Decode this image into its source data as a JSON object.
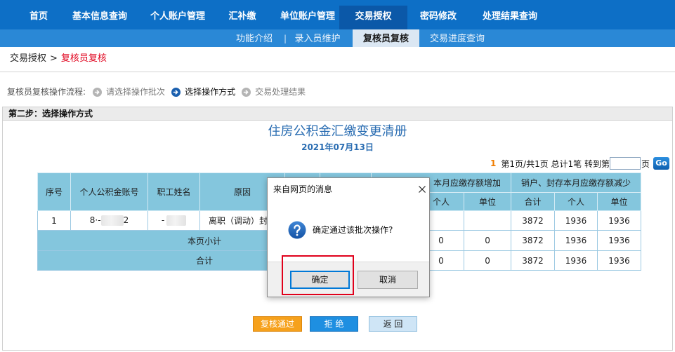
{
  "colors": {
    "nav_bg": "#0d6fc6",
    "nav_active": "#0b58a8",
    "subnav_bg": "#2a88d6",
    "subnav_active": "#dbe7f3",
    "breadcrumb_current": "#e0001b",
    "table_header": "#84c6dd",
    "report_title": "#2a6db2",
    "page_current": "#f07d00",
    "approve_button": "#f6a11c",
    "reject_button": "#1e8fe1",
    "back_button": "#cfe5f6",
    "highlight_box": "#e0001b"
  },
  "topnav": {
    "items": [
      {
        "label": "首页"
      },
      {
        "label": "基本信息查询"
      },
      {
        "label": "个人账户管理"
      },
      {
        "label": "汇补缴"
      },
      {
        "label": "单位账户管理"
      },
      {
        "label": "交易授权",
        "active": true
      },
      {
        "label": "密码修改"
      },
      {
        "label": "处理结果查询"
      }
    ]
  },
  "subnav": {
    "separator": "|",
    "items": [
      {
        "label": "功能介绍"
      },
      {
        "label": "录入员维护"
      },
      {
        "label": "复核员复核",
        "active": true
      },
      {
        "label": "交易进度查询"
      }
    ]
  },
  "breadcrumb": {
    "parent": "交易授权",
    "separator": ">",
    "current": "复核员复核"
  },
  "flow": {
    "label": "复核员复核操作流程:",
    "step_icon": "arrow-circle-icon",
    "steps": [
      {
        "label": "请选择操作批次"
      },
      {
        "label": "选择操作方式",
        "current": true
      },
      {
        "label": "交易处理结果"
      }
    ]
  },
  "panel": {
    "heading": "第二步：选择操作方式"
  },
  "report": {
    "title": "住房公积金汇缴变更清册",
    "date": "2021年07月13日"
  },
  "pagination": {
    "current": "1",
    "summary": "第1页/共1页 总计1笔 转到第",
    "suffix": "页",
    "go_label": "Go"
  },
  "table": {
    "headers": {
      "seq": "序号",
      "account": "个人公积金账号",
      "name": "职工姓名",
      "reason": "原因",
      "increase_group": "本月应缴存额增加",
      "increase_personal": "个人",
      "increase_unit": "单位",
      "decrease_group": "销户、封存本月应缴存额减少",
      "decrease_total": "合计",
      "decrease_personal": "个人",
      "decrease_unit": "单位"
    },
    "rows": [
      {
        "seq": "1",
        "account_prefix": "8·-",
        "account_suffix": "2",
        "name_prefix": "-",
        "reason": "离职（调动）封",
        "decrease_total": "3872",
        "decrease_personal": "1936",
        "decrease_unit": "1936"
      }
    ],
    "subtotal": {
      "label": "本页小计",
      "increase_personal": "0",
      "increase_unit": "0",
      "decrease_total": "3872",
      "decrease_personal": "1936",
      "decrease_unit": "1936"
    },
    "total": {
      "label": "合计",
      "increase_personal": "0",
      "increase_unit": "0",
      "decrease_total": "3872",
      "decrease_personal": "1936",
      "decrease_unit": "1936"
    }
  },
  "dialog": {
    "title": "来自网页的消息",
    "message": "确定通过该批次操作?",
    "ok_label": "确定",
    "cancel_label": "取消",
    "icon": "question-icon",
    "close_icon": "close-icon"
  },
  "actions": {
    "approve_label": "复核通过",
    "reject_label": "拒 绝",
    "back_label": "返 回"
  }
}
